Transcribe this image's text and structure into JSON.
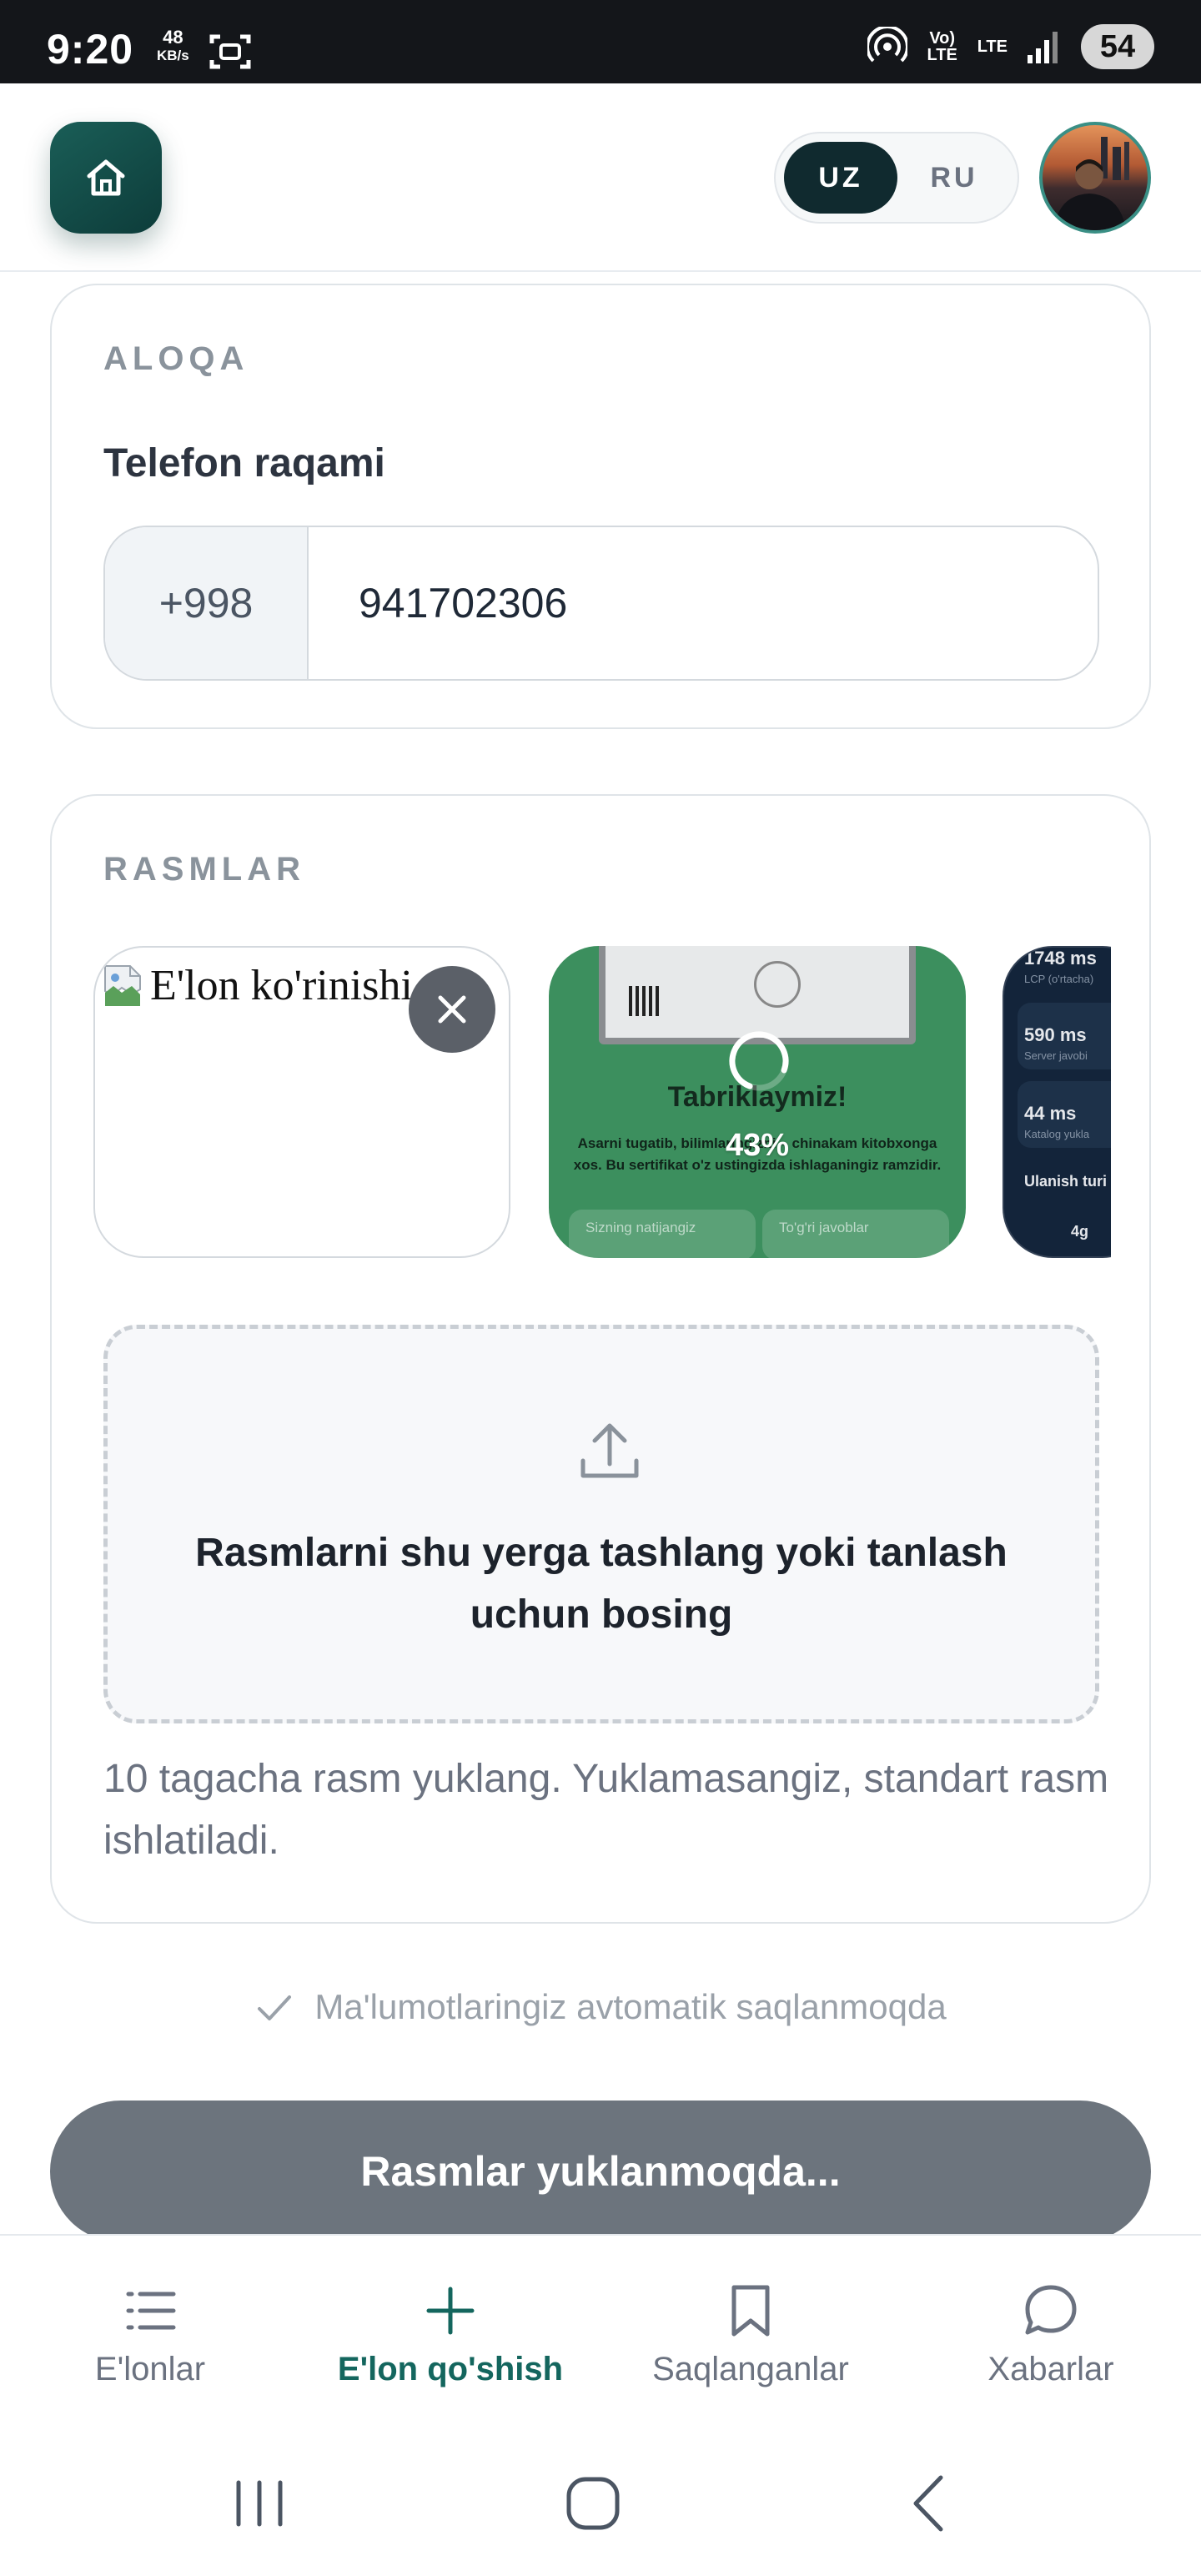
{
  "status_bar": {
    "time": "9:20",
    "speed_value": "48",
    "speed_unit": "KB/s",
    "net_tag_1": "Vo) LTE",
    "net_tag_2": "LTE",
    "battery": "54"
  },
  "header": {
    "lang_uz": "UZ",
    "lang_ru": "RU",
    "active_lang": "UZ"
  },
  "contact": {
    "section_label": "ALOQA",
    "phone_label": "Telefon raqami",
    "country_code": "+998",
    "phone_value": "941702306"
  },
  "photos": {
    "section_label": "RASMLAR",
    "thumb_1_alt": "E'lon ko'rinishi",
    "thumb_2": {
      "title": "Tabriklaymiz!",
      "text": "Asarni tugatib, bilimlaringizni – chinakam kitobxonga xos. Bu sertifikat o'z ustingizda ishlaganingiz ramzidir.",
      "box_1": "Sizning natijangiz",
      "box_2": "To'g'ri javoblar",
      "progress": "43%"
    },
    "thumb_3": {
      "stat_1": "1748 ms",
      "stat_1_sub": "LCP (o'rtacha)",
      "stat_2": "590 ms",
      "stat_2_sub": "Server javobi",
      "stat_3": "44 ms",
      "stat_3_sub": "Katalog yukla",
      "stat_4": "Ulanish turi",
      "stat_5": "4g"
    },
    "dropzone_text": "Rasmlarni shu yerga tashlang yoki tanlash uchun bosing",
    "help_text": "10 tagacha rasm yuklang. Yuklamasangiz, standart rasm ishlatiladi."
  },
  "autosave_text": "Ma'lumotlaringiz avtomatik saqlanmoqda",
  "submit_label": "Rasmlar yuklanmoqda...",
  "bottom_nav": {
    "items": [
      {
        "label": "E'lonlar",
        "icon": "list-icon"
      },
      {
        "label": "E'lon qo'shish",
        "icon": "plus-icon",
        "active": true
      },
      {
        "label": "Saqlanganlar",
        "icon": "bookmark-icon"
      },
      {
        "label": "Xabarlar",
        "icon": "chat-bubble-icon"
      }
    ]
  },
  "colors": {
    "brand": "#14665e",
    "brand_dark": "#0d3c3a",
    "disabled_button": "#6c747d"
  }
}
